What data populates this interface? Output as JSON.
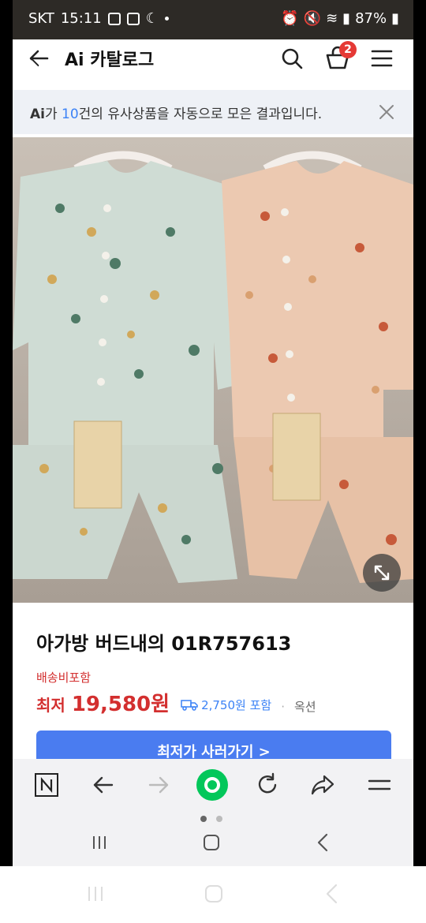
{
  "status": {
    "carrier": "SKT",
    "time": "15:11",
    "battery": "87%"
  },
  "header": {
    "title": "Ai 카탈로그",
    "cart_count": "2"
  },
  "notice": {
    "ai": "Ai",
    "text_a": "가 ",
    "count": "10",
    "text_b": "건의 유사상품을 자동으로 모은 결과입니다."
  },
  "product": {
    "title": "아가방 버드내의 01R757613",
    "shipping_label": "배송비포함",
    "price_prefix": "최저",
    "price": "19,580원",
    "shipping_fee": "2,750원 포함",
    "option": "옥션",
    "buy_button": "최저가 사러가기 >"
  },
  "colors": {
    "accent_blue": "#4a7cf0",
    "price_red": "#d32f2f",
    "link_blue": "#3b82f6",
    "badge_red": "#e53935",
    "naver_green": "#03c75a"
  },
  "toolbar": {
    "icons": [
      "naver-n-icon",
      "back-arrow-icon",
      "forward-arrow-icon",
      "naver-green-icon",
      "refresh-icon",
      "share-icon",
      "menu-icon"
    ]
  }
}
